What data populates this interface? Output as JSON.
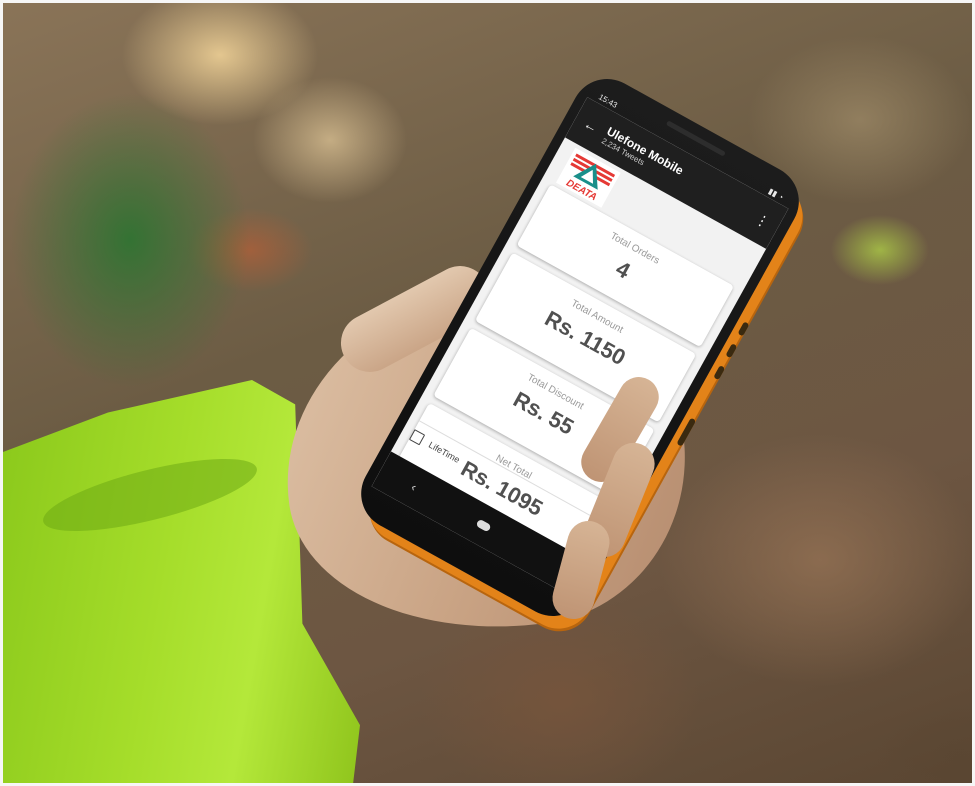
{
  "status": {
    "time": "15:43"
  },
  "app": {
    "title": "Ulefone Mobile",
    "subtitle": "2,234 Tweets",
    "logo_text": "DEATA"
  },
  "cards": [
    {
      "label": "Total Orders",
      "value": "4"
    },
    {
      "label": "Total Amount",
      "value": "Rs. 1150"
    },
    {
      "label": "Total Discount",
      "value": "Rs. 55"
    },
    {
      "label": "Net Total",
      "value": "Rs. 1095"
    }
  ],
  "footer": {
    "period": "LifeTime"
  },
  "colors": {
    "phone_accent": "#e38319",
    "sleeve": "#a5dd2a",
    "logo_red": "#e53935",
    "logo_teal": "#1a8f8a"
  },
  "icons": {
    "back": "back-arrow-icon",
    "menu": "more-vert-icon",
    "calendar": "calendar-icon"
  }
}
